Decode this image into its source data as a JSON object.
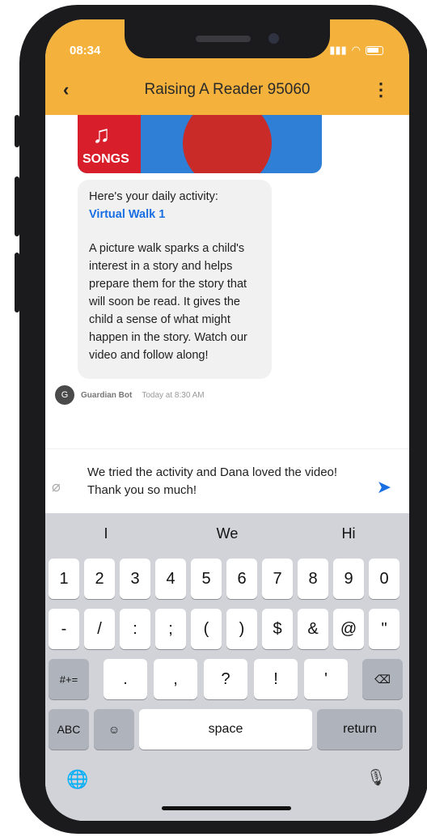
{
  "status_bar": {
    "time": "08:34"
  },
  "header": {
    "back_icon": "chevron-left-icon",
    "title": "Raising A Reader 95060",
    "more_icon": "more-vertical-icon"
  },
  "media_card": {
    "badge_label": "SONGS",
    "icon": "music-note-icon"
  },
  "message": {
    "intro": "Here's your daily activity:",
    "link": "Virtual Walk 1",
    "body": "A picture walk sparks a child's interest in a story and helps prepare them for the story that will soon be read. It gives the child a sense of what might happen in the story. Watch our video and follow along!",
    "sender_initial": "G",
    "sender_name": "Guardian Bot",
    "timestamp": "Today at 8:30 AM"
  },
  "composer": {
    "text": "We tried the activity and Dana loved the video! Thank you so much!",
    "attach_icon": "paperclip-icon",
    "send_icon": "send-icon"
  },
  "keyboard": {
    "suggestions": [
      "I",
      "We",
      "Hi"
    ],
    "row1": [
      "1",
      "2",
      "3",
      "4",
      "5",
      "6",
      "7",
      "8",
      "9",
      "0"
    ],
    "row2": [
      "-",
      "/",
      ":",
      ";",
      "(",
      ")",
      "$",
      "&",
      "@",
      "\""
    ],
    "row3_mode": "#+=",
    "row3": [
      ".",
      ",",
      "?",
      "!",
      "'"
    ],
    "delete_icon": "backspace-icon",
    "abc_label": "ABC",
    "emoji_icon": "emoji-icon",
    "space_label": "space",
    "return_label": "return",
    "globe_icon": "globe-icon",
    "mic_icon": "microphone-icon"
  }
}
